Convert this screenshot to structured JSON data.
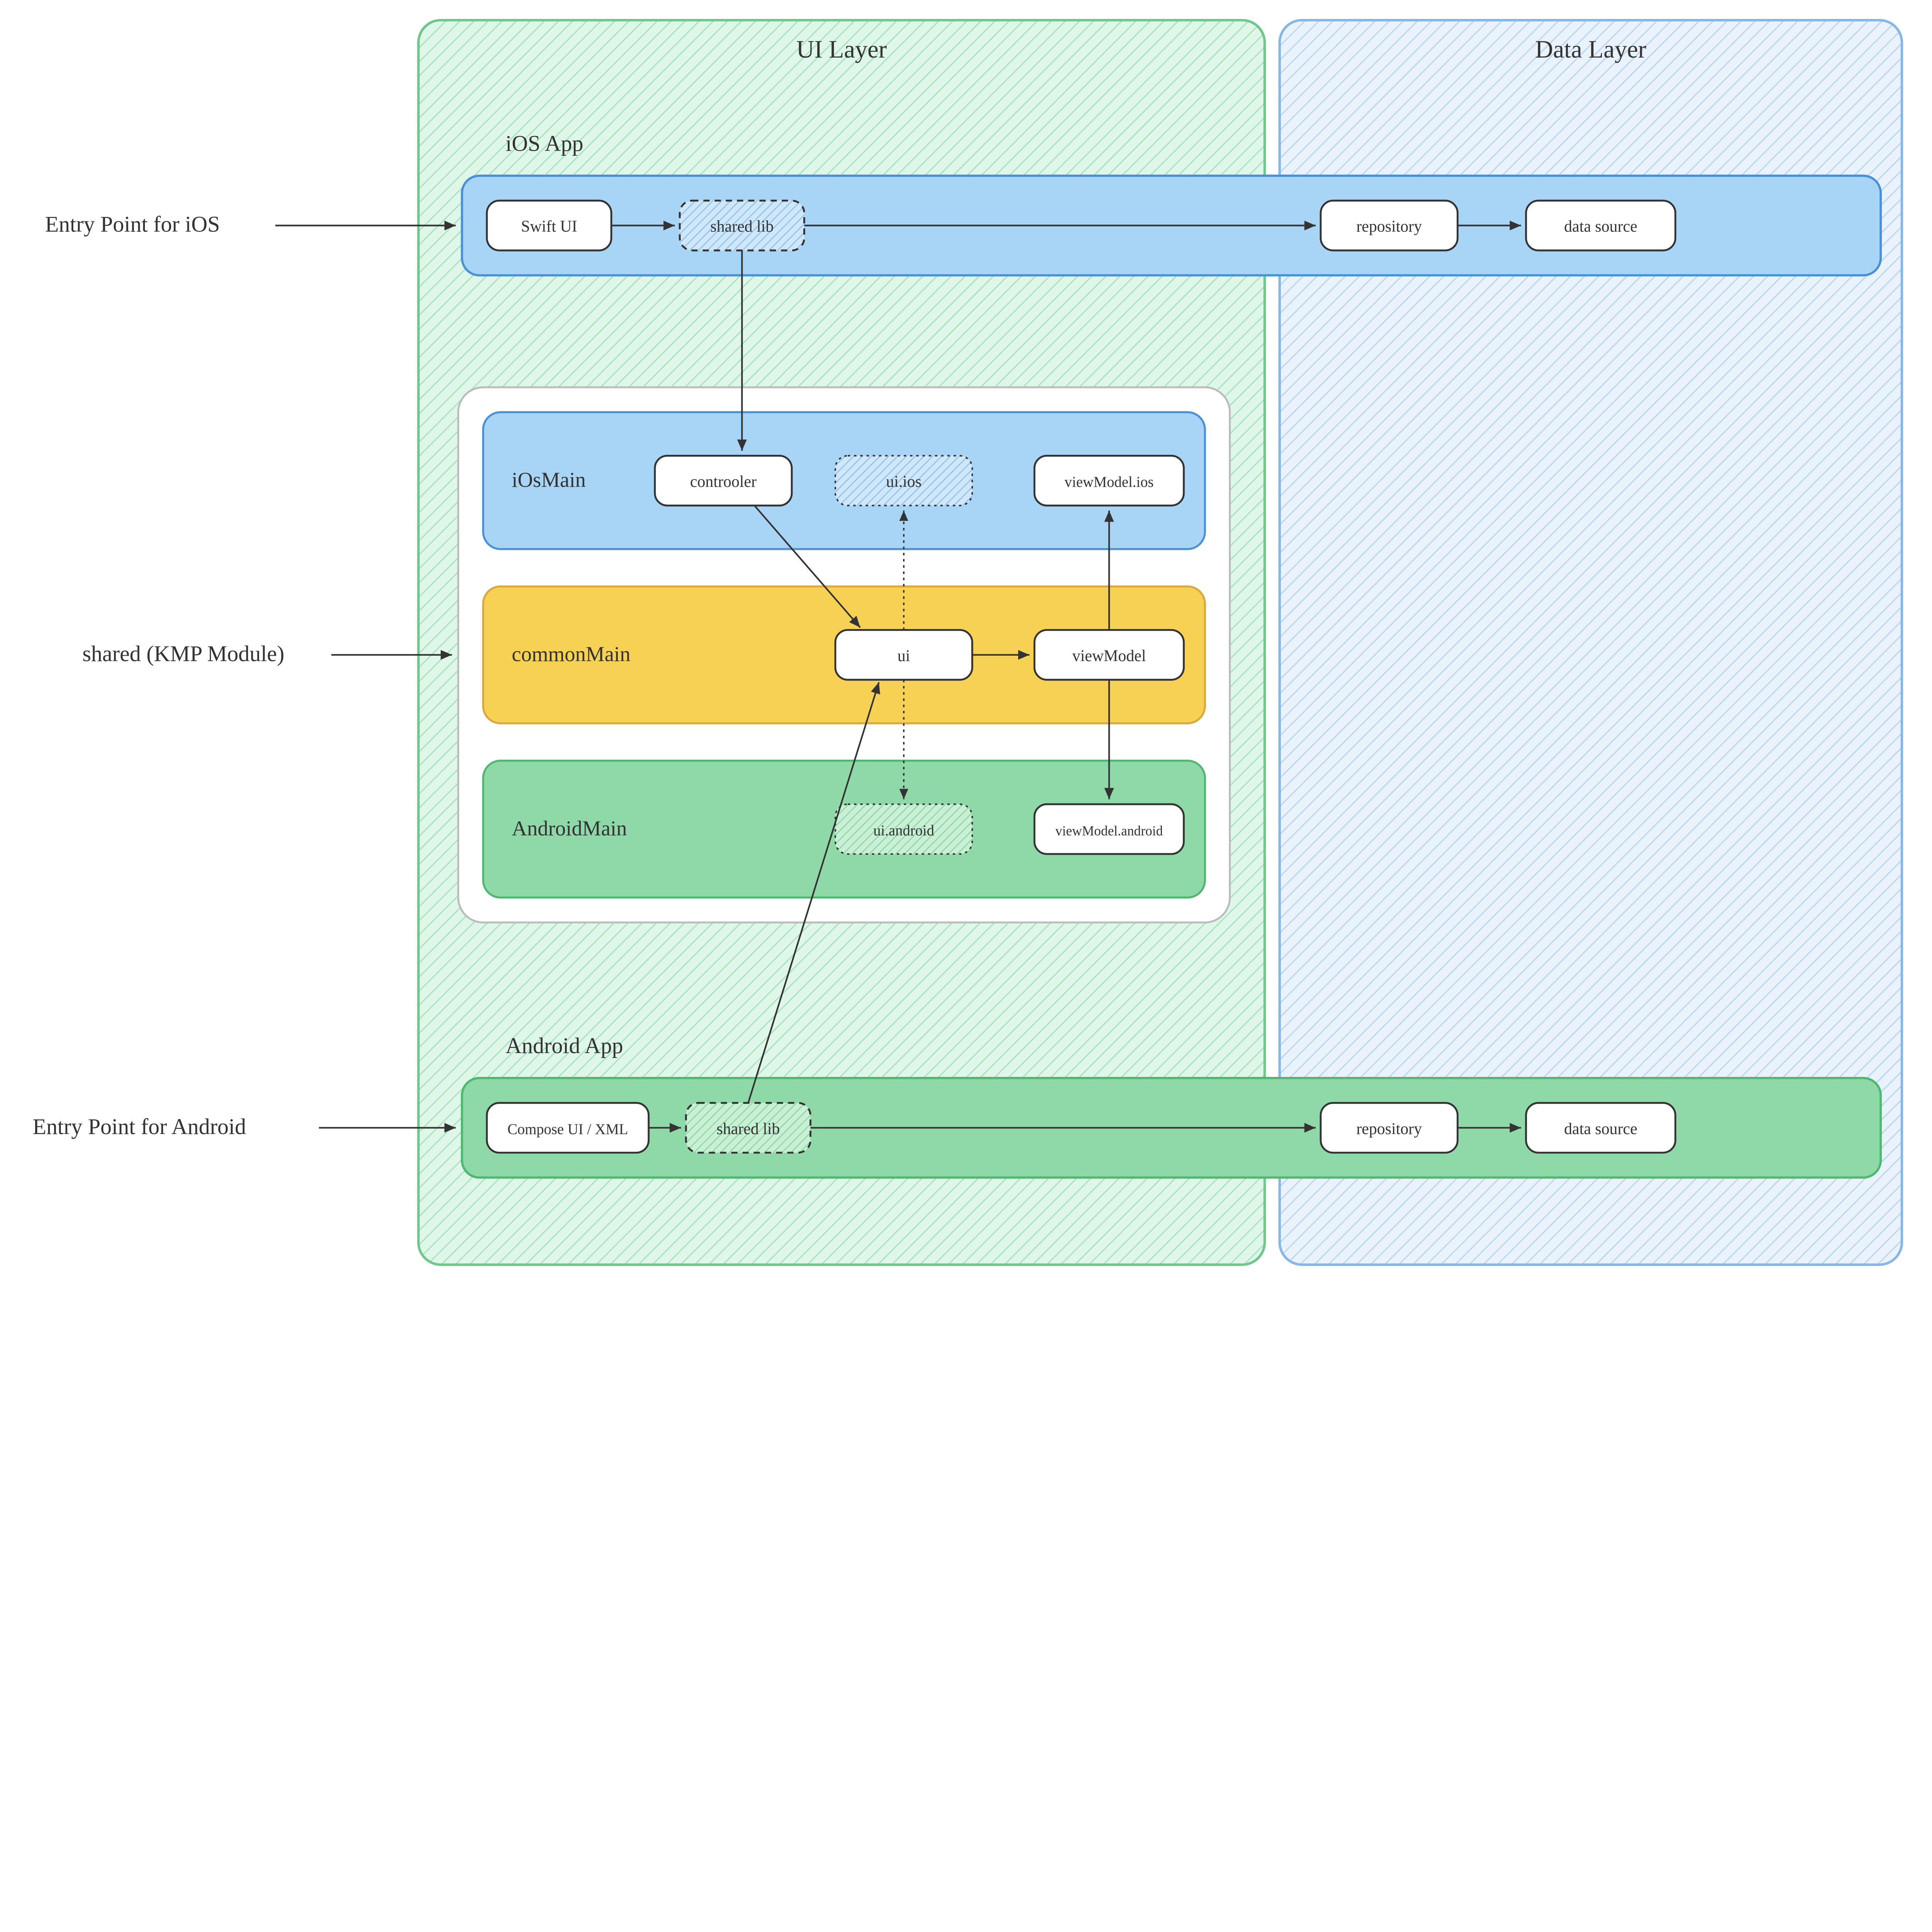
{
  "layers": {
    "ui": "UI Layer",
    "data": "Data Layer"
  },
  "labels": {
    "entry_ios": "Entry Point for iOS",
    "entry_android": "Entry Point for Android",
    "kmp": "shared (KMP Module)"
  },
  "ios_app": {
    "title": "iOS App",
    "swift_ui": "Swift UI",
    "shared_lib": "shared lib",
    "repository": "repository",
    "data_source": "data source"
  },
  "android_app": {
    "title": "Android App",
    "compose": "Compose UI / XML",
    "shared_lib": "shared lib",
    "repository": "repository",
    "data_source": "data source"
  },
  "kmp_module": {
    "iosmain": {
      "title": "iOsMain",
      "controller": "controoler",
      "ui_ios": "ui.ios",
      "viewmodel_ios": "viewModel.ios"
    },
    "commonmain": {
      "title": "commonMain",
      "ui": "ui",
      "viewmodel": "viewModel"
    },
    "androidmain": {
      "title": "AndroidMain",
      "ui_android": "ui.android",
      "viewmodel_android": "viewModel.android"
    }
  },
  "colors": {
    "blue_fill": "#a8d5f5",
    "blue_stroke": "#4a90d9",
    "yellow_fill": "#f7d154",
    "yellow_stroke": "#d9a93d",
    "green_fill": "#8fd9a8",
    "green_stroke": "#4fb76f",
    "green_light": "#dff5e5",
    "blue_light": "#e6f0fb"
  }
}
